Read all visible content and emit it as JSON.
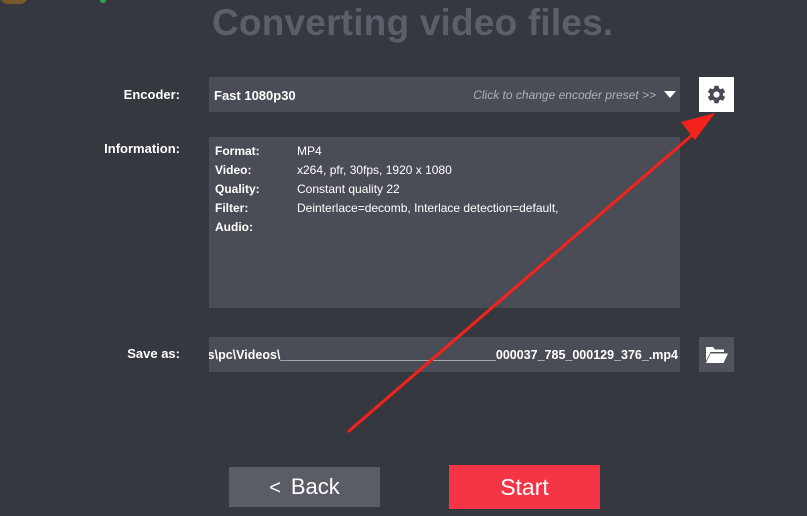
{
  "page": {
    "title": "Converting video files."
  },
  "encoder": {
    "label": "Encoder:",
    "value": "Fast 1080p30",
    "hint": "Click to change encoder preset >>",
    "settings_icon": "gear-icon",
    "dropdown_icon": "caret-down-icon"
  },
  "information": {
    "label": "Information:",
    "rows": [
      {
        "key": "Format:",
        "value": "MP4"
      },
      {
        "key": "Video:",
        "value": "x264, pfr, 30fps, 1920 x 1080"
      },
      {
        "key": "Quality:",
        "value": "Constant quality 22"
      },
      {
        "key": "Filter:",
        "value": "Deinterlace=decomb, Interlace detection=default,"
      },
      {
        "key": "Audio:",
        "value": ""
      }
    ]
  },
  "save_as": {
    "label": "Save as:",
    "value": "s\\pc\\Videos\\_______________________________000037_785_000129_376_.mp4",
    "browse_icon": "folder-open-icon"
  },
  "buttons": {
    "back_chevron": "<",
    "back": "Back",
    "start": "Start"
  },
  "colors": {
    "background": "#363840",
    "field": "#4b4d56",
    "start_accent": "#f53446",
    "annotation_arrow": "#f5221c"
  }
}
